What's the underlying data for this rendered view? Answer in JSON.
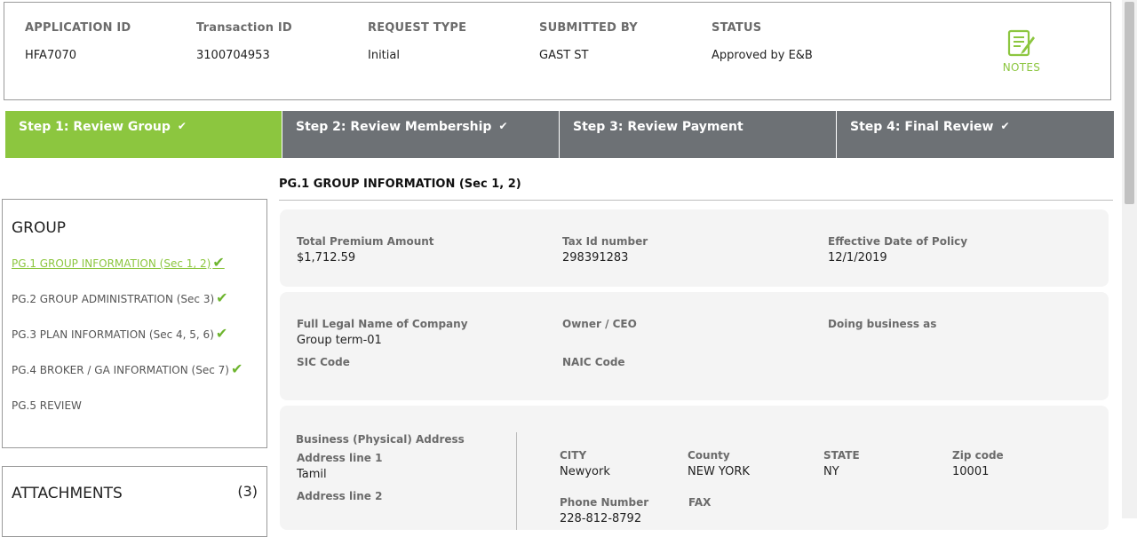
{
  "header": {
    "fields": [
      {
        "label": "APPLICATION ID",
        "value": "HFA7070"
      },
      {
        "label": "Transaction ID",
        "value": "3100704953"
      },
      {
        "label": "REQUEST TYPE",
        "value": "Initial"
      },
      {
        "label": "SUBMITTED BY",
        "value": "GAST ST"
      },
      {
        "label": "STATUS",
        "value": "Approved by E&B"
      }
    ],
    "notes_label": "NOTES"
  },
  "steps": [
    {
      "label": "Step 1: Review Group",
      "check": "✔"
    },
    {
      "label": "Step 2: Review Membership",
      "check": "✔"
    },
    {
      "label": "Step 3: Review Payment",
      "check": ""
    },
    {
      "label": "Step 4: Final Review",
      "check": "✔"
    }
  ],
  "group_panel": {
    "title": "GROUP",
    "items": [
      {
        "label": "PG.1 GROUP INFORMATION (Sec 1, 2)",
        "tick": "✔"
      },
      {
        "label": "PG.2 GROUP ADMINISTRATION (Sec 3)",
        "tick": "✔"
      },
      {
        "label": "PG.3 PLAN INFORMATION (Sec 4, 5, 6)",
        "tick": "✔"
      },
      {
        "label": "PG.4 BROKER / GA INFORMATION (Sec 7)",
        "tick": "✔"
      },
      {
        "label": "PG.5 REVIEW",
        "tick": ""
      }
    ]
  },
  "attachments": {
    "title": "ATTACHMENTS",
    "count": "(3)"
  },
  "section_title": "PG.1 GROUP INFORMATION (Sec 1, 2)",
  "card1": {
    "total_premium": {
      "label": "Total Premium Amount",
      "value": "$1,712.59"
    },
    "tax_id": {
      "label": "Tax Id number",
      "value": "298391283"
    },
    "effective_date": {
      "label": "Effective Date of Policy",
      "value": "12/1/2019"
    }
  },
  "card2": {
    "legal_name": {
      "label": "Full Legal Name of Company",
      "value": "Group term-01"
    },
    "owner": {
      "label": "Owner / CEO",
      "value": ""
    },
    "dba": {
      "label": "Doing business as",
      "value": ""
    },
    "sic": {
      "label": "SIC Code",
      "value": ""
    },
    "naic": {
      "label": "NAIC Code",
      "value": ""
    }
  },
  "card3": {
    "address_heading": "Business (Physical) Address",
    "address1": {
      "label": "Address line 1",
      "value": "Tamil"
    },
    "address2": {
      "label": "Address line 2",
      "value": ""
    },
    "city": {
      "label": "CITY",
      "value": "Newyork"
    },
    "county": {
      "label": "County",
      "value": "NEW YORK"
    },
    "state": {
      "label": "STATE",
      "value": "NY"
    },
    "zip": {
      "label": "Zip code",
      "value": "10001"
    },
    "phone": {
      "label": "Phone Number",
      "value": "228-812-8792"
    },
    "fax": {
      "label": "FAX",
      "value": ""
    }
  },
  "colors": {
    "accent": "#8cc63f",
    "step_inactive": "#6d7175"
  }
}
